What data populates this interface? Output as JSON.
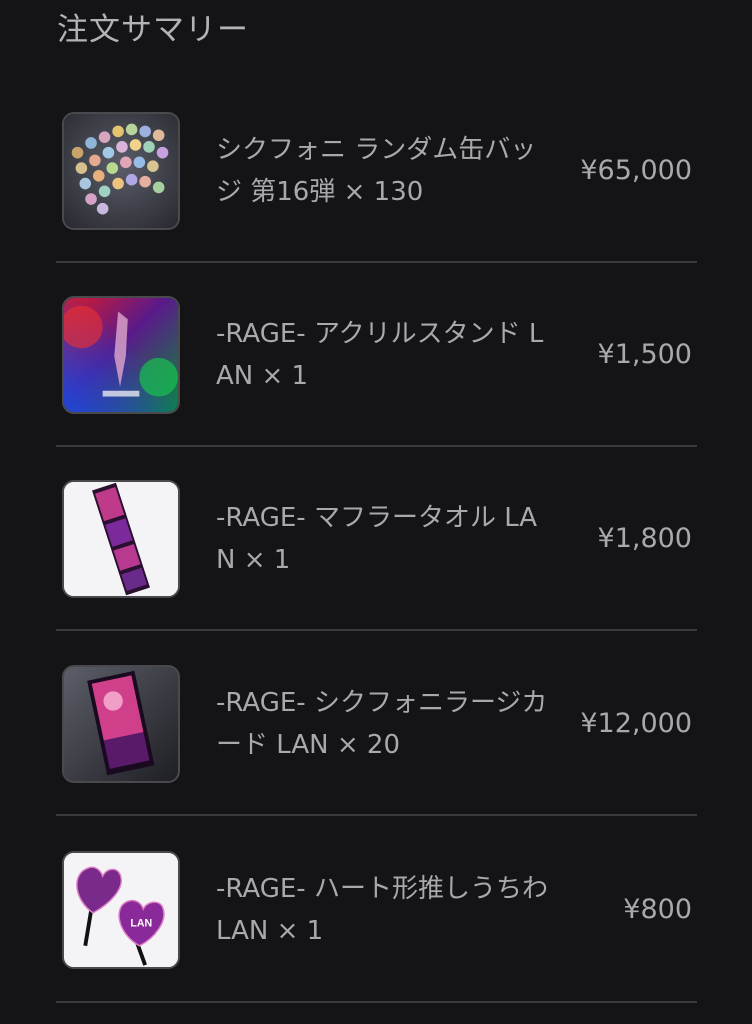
{
  "summary": {
    "title": "注文サマリー"
  },
  "items": [
    {
      "name": "シクフォニ ランダム缶バッジ 第16弾 × 130",
      "price": "¥65,000",
      "thumbnail_icon": "badge-collection-image"
    },
    {
      "name": "-RAGE- アクリルスタンド LAN × 1",
      "price": "¥1,500",
      "thumbnail_icon": "acrylic-stand-image"
    },
    {
      "name": "-RAGE- マフラータオル LAN × 1",
      "price": "¥1,800",
      "thumbnail_icon": "muffler-towel-image"
    },
    {
      "name": "-RAGE- シクフォニラージカード LAN × 20",
      "price": "¥12,000",
      "thumbnail_icon": "large-card-image"
    },
    {
      "name": "-RAGE- ハート形推しうちわ LAN × 1",
      "price": "¥800",
      "thumbnail_icon": "heart-fan-image",
      "fan_label": "LAN"
    }
  ]
}
